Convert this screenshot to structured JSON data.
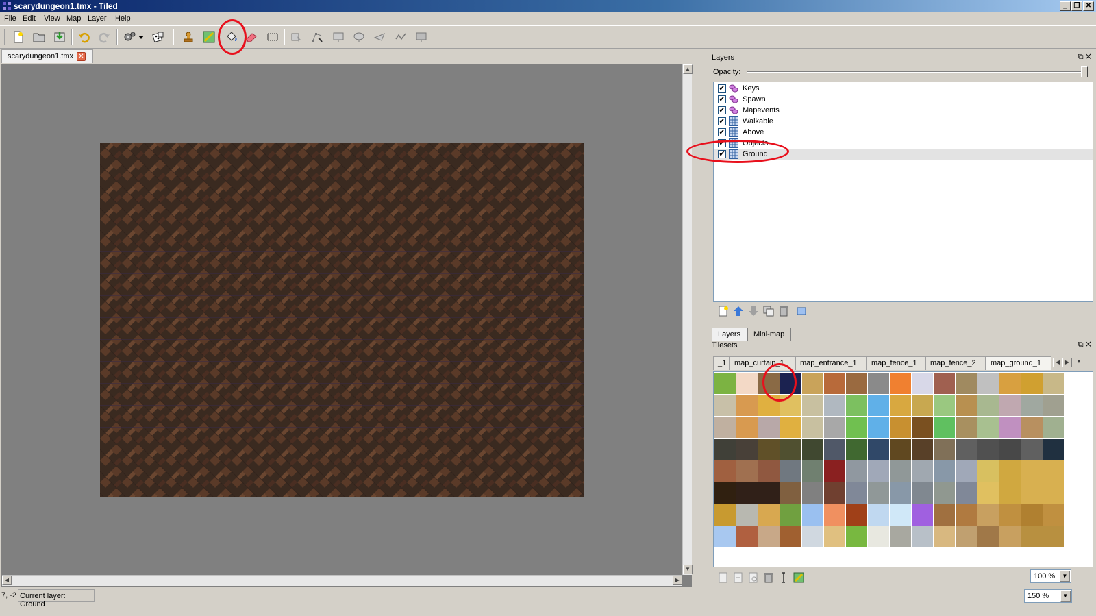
{
  "window": {
    "title": "scarydungeon1.tmx - Tiled"
  },
  "menu": [
    "File",
    "Edit",
    "View",
    "Map",
    "Layer",
    "Help"
  ],
  "toolbar": {
    "icons": [
      "new-file-icon",
      "open-folder-icon",
      "save-icon",
      "undo-icon",
      "redo-icon",
      "command-icon",
      "random-dice-icon",
      "stamp-brush-icon",
      "terrain-brush-icon",
      "bucket-fill-icon",
      "eraser-icon",
      "rectangular-select-icon",
      "select-objects-icon",
      "edit-polygons-icon",
      "insert-rectangle-icon",
      "insert-ellipse-icon",
      "insert-polygon-icon",
      "insert-polyline-icon",
      "insert-tile-icon"
    ]
  },
  "document": {
    "tab_label": "scarydungeon1.tmx"
  },
  "colors": {
    "accent_annotation": "#e8101c",
    "map_tile_dark": "#3a2a20",
    "map_tile_light": "#5a3a28",
    "selection": "#e3e3e3"
  },
  "layers_dock": {
    "title": "Layers",
    "opacity_label": "Opacity:",
    "opacity_value": 1.0,
    "layers": [
      {
        "name": "Keys",
        "type": "object",
        "visible": true
      },
      {
        "name": "Spawn",
        "type": "object",
        "visible": true
      },
      {
        "name": "Mapevents",
        "type": "object",
        "visible": true
      },
      {
        "name": "Walkable",
        "type": "tile",
        "visible": true
      },
      {
        "name": "Above",
        "type": "tile",
        "visible": true
      },
      {
        "name": "Objects",
        "type": "tile",
        "visible": true
      },
      {
        "name": "Ground",
        "type": "tile",
        "visible": true,
        "selected": true
      }
    ],
    "tabs": [
      "Layers",
      "Mini-map"
    ]
  },
  "tilesets_dock": {
    "title": "Tilesets",
    "tabs": [
      "_1",
      "map_curtain_1",
      "map_entrance_1",
      "map_fence_1",
      "map_fence_2",
      "map_ground_1"
    ],
    "active_tab": "map_ground_1",
    "zoom": "100 %"
  },
  "status": {
    "coords": "7, -2",
    "current_layer": "Current layer: Ground",
    "zoom": "150 %"
  }
}
